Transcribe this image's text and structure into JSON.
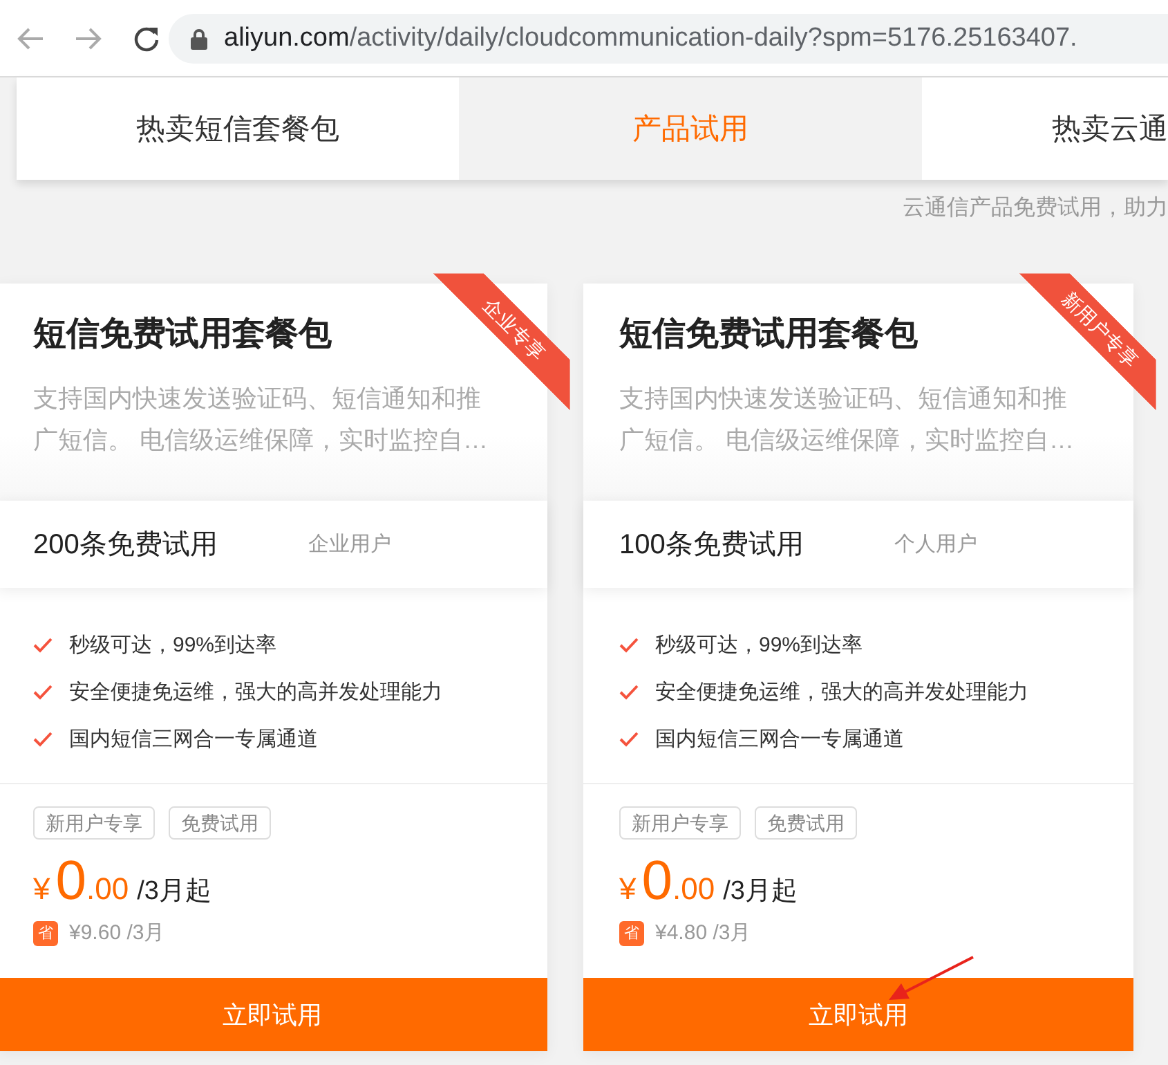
{
  "browser": {
    "url_host": "aliyun.com",
    "url_path": "/activity/daily/cloudcommunication-daily?spm=5176.25163407."
  },
  "tabs": [
    {
      "label": "热卖短信套餐包",
      "selected": false
    },
    {
      "label": "产品试用",
      "selected": true
    },
    {
      "label": "热卖云通",
      "selected": false
    }
  ],
  "subtitle": "云通信产品免费试用，助力",
  "cards": [
    {
      "ribbon": "企业专享",
      "title": "短信免费试用套餐包",
      "description": "支持国内快速发送验证码、短信通知和推广短信。 电信级运维保障，实时监控自…",
      "plan": {
        "quota": "200条免费试用",
        "audience": "企业用户"
      },
      "features": [
        "秒级可达，99%到达率",
        "安全便捷免运维，强大的高并发处理能力",
        "国内短信三网合一专属通道"
      ],
      "tags": [
        "新用户专享",
        "免费试用"
      ],
      "price": {
        "currency": "¥",
        "integer": "0",
        "decimal": ".00",
        "unit": "/3月起"
      },
      "saving": {
        "badge": "省",
        "amount": "¥9.60 /3月"
      },
      "button": "立即试用"
    },
    {
      "ribbon": "新用户专享",
      "title": "短信免费试用套餐包",
      "description": "支持国内快速发送验证码、短信通知和推广短信。 电信级运维保障，实时监控自…",
      "plan": {
        "quota": "100条免费试用",
        "audience": "个人用户"
      },
      "features": [
        "秒级可达，99%到达率",
        "安全便捷免运维，强大的高并发处理能力",
        "国内短信三网合一专属通道"
      ],
      "tags": [
        "新用户专享",
        "免费试用"
      ],
      "price": {
        "currency": "¥",
        "integer": "0",
        "decimal": ".00",
        "unit": "/3月起"
      },
      "saving": {
        "badge": "省",
        "amount": "¥4.80 /3月"
      },
      "button": "立即试用"
    }
  ]
}
